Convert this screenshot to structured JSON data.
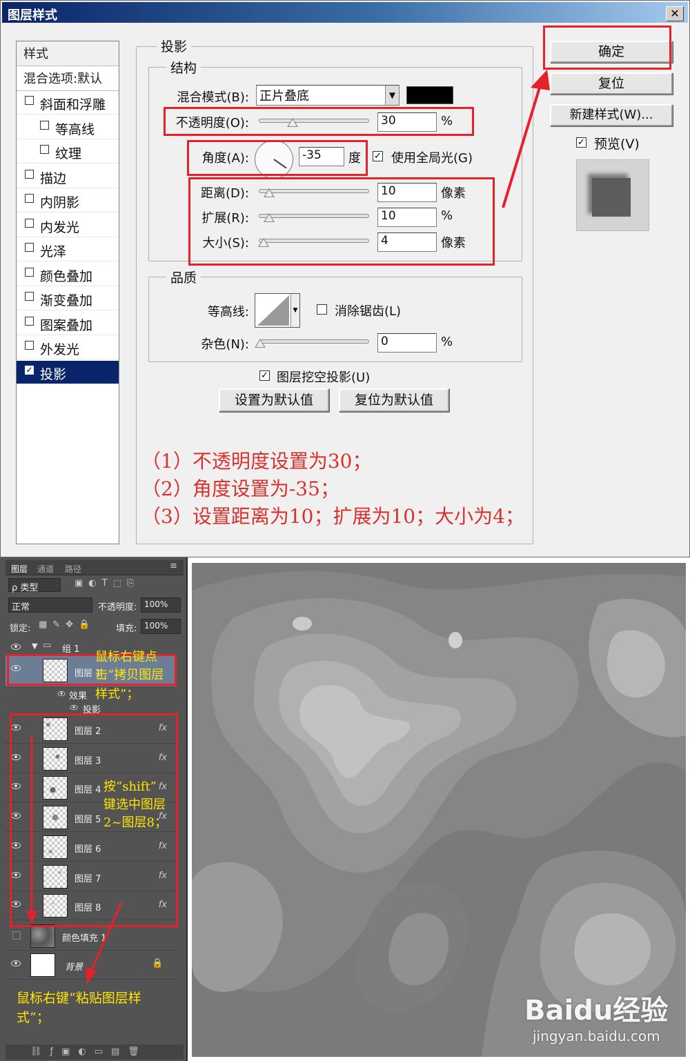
{
  "dialog": {
    "title": "图层样式",
    "close": "✕",
    "styles_header": "样式",
    "blend_default": "混合选项:默认",
    "styles": [
      {
        "label": "斜面和浮雕",
        "checked": false,
        "indent": false
      },
      {
        "label": "等高线",
        "checked": false,
        "indent": true
      },
      {
        "label": "纹理",
        "checked": false,
        "indent": true
      },
      {
        "label": "描边",
        "checked": false,
        "indent": false
      },
      {
        "label": "内阴影",
        "checked": false,
        "indent": false
      },
      {
        "label": "内发光",
        "checked": false,
        "indent": false
      },
      {
        "label": "光泽",
        "checked": false,
        "indent": false
      },
      {
        "label": "颜色叠加",
        "checked": false,
        "indent": false
      },
      {
        "label": "渐变叠加",
        "checked": false,
        "indent": false
      },
      {
        "label": "图案叠加",
        "checked": false,
        "indent": false
      },
      {
        "label": "外发光",
        "checked": false,
        "indent": false
      },
      {
        "label": "投影",
        "checked": true,
        "indent": false,
        "selected": true
      }
    ],
    "section_title": "投影",
    "structure": {
      "title": "结构",
      "blend_mode_label": "混合模式(B):",
      "blend_mode_value": "正片叠底",
      "blend_color": "#000000",
      "opacity_label": "不透明度(O):",
      "opacity_value": "30",
      "opacity_unit": "%",
      "opacity_level": 0.3,
      "angle_label": "角度(A):",
      "angle_value": "-35",
      "angle_unit": "度",
      "global_light_label": "使用全局光(G)",
      "global_light_checked": true,
      "distance_label": "距离(D):",
      "distance_value": "10",
      "distance_unit": "像素",
      "spread_label": "扩展(R):",
      "spread_value": "10",
      "spread_unit": "%",
      "size_label": "大小(S):",
      "size_value": "4",
      "size_unit": "像素"
    },
    "quality": {
      "title": "品质",
      "contour_label": "等高线:",
      "antialias_label": "消除锯齿(L)",
      "antialias_checked": false,
      "noise_label": "杂色(N):",
      "noise_value": "0",
      "noise_unit": "%"
    },
    "knockout_label": "图层挖空投影(U)",
    "knockout_checked": true,
    "make_default": "设置为默认值",
    "reset_default": "复位为默认值",
    "ok": "确定",
    "reset": "复位",
    "new_style": "新建样式(W)...",
    "preview_label": "预览(V)",
    "preview_checked": true,
    "notes": [
      "（1）不透明度设置为30；",
      "（2）角度设置为-35；",
      "（3）设置距离为10；扩展为10；大小为4；"
    ]
  },
  "layers": {
    "tabs": [
      "图层",
      "通道",
      "路径"
    ],
    "filter_kind": "ρ 类型",
    "blend_mode": "正常",
    "opacity_label": "不透明度:",
    "opacity_value": "100%",
    "lock_label": "锁定:",
    "fill_label": "填充:",
    "fill_value": "100%",
    "group_name": "组 1",
    "top_layer": "图层 1",
    "effects_label": "效果",
    "drop_shadow_label": "投影",
    "layer_list": [
      "图层 2",
      "图层 3",
      "图层 4",
      "图层 5",
      "图层 6",
      "图层 7",
      "图层 8"
    ],
    "fx": "fx",
    "color_fill": "颜色填充 1",
    "background": "背景",
    "notes": {
      "copy_1": "鼠标右键点",
      "copy_2": "击“拷贝图层",
      "copy_3": "样式”；",
      "shift_1": "按“shift”",
      "shift_2": "键选中图层",
      "shift_3": "2~图层8；",
      "paste_1": "鼠标右键“粘贴图层样",
      "paste_2": "式”；"
    }
  },
  "watermark": {
    "brand": "Baidu经验",
    "url": "jingyan.baidu.com"
  },
  "colors": {
    "annotation_red": "#e8202a",
    "annotation_yellow": "#ffe600",
    "selection_blue": "#0a246a"
  }
}
